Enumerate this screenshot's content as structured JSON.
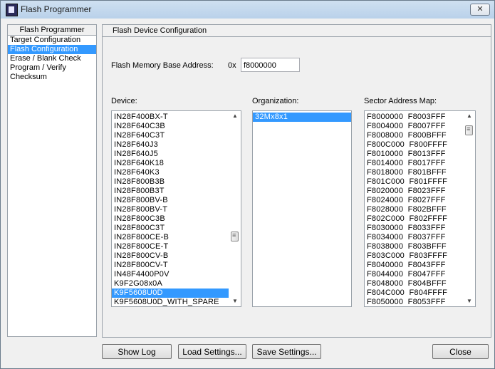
{
  "window": {
    "title": "Flash Programmer",
    "close_label": "✕"
  },
  "nav": {
    "header": "Flash Programmer",
    "items": [
      {
        "label": "Target Configuration",
        "selected": false
      },
      {
        "label": "Flash Configuration",
        "selected": true
      },
      {
        "label": "Erase / Blank Check",
        "selected": false
      },
      {
        "label": "Program / Verify",
        "selected": false
      },
      {
        "label": "Checksum",
        "selected": false
      }
    ]
  },
  "config": {
    "header": "Flash Device Configuration",
    "base_address_label": "Flash Memory Base Address:",
    "base_address_prefix": "0x",
    "base_address_value": "f8000000",
    "device_label": "Device:",
    "organization_label": "Organization:",
    "sector_label": "Sector Address Map:",
    "devices": [
      {
        "label": "IN28F400BX-T",
        "selected": false
      },
      {
        "label": "IN28F640C3B",
        "selected": false
      },
      {
        "label": "IN28F640C3T",
        "selected": false
      },
      {
        "label": "IN28F640J3",
        "selected": false
      },
      {
        "label": "IN28F640J5",
        "selected": false
      },
      {
        "label": "IN28F640K18",
        "selected": false
      },
      {
        "label": "IN28F640K3",
        "selected": false
      },
      {
        "label": "IN28F800B3B",
        "selected": false
      },
      {
        "label": "IN28F800B3T",
        "selected": false
      },
      {
        "label": "IN28F800BV-B",
        "selected": false
      },
      {
        "label": "IN28F800BV-T",
        "selected": false
      },
      {
        "label": "IN28F800C3B",
        "selected": false
      },
      {
        "label": "IN28F800C3T",
        "selected": false
      },
      {
        "label": "IN28F800CE-B",
        "selected": false
      },
      {
        "label": "IN28F800CE-T",
        "selected": false
      },
      {
        "label": "IN28F800CV-B",
        "selected": false
      },
      {
        "label": "IN28F800CV-T",
        "selected": false
      },
      {
        "label": "IN48F4400P0V",
        "selected": false
      },
      {
        "label": "K9F2G08x0A",
        "selected": false
      },
      {
        "label": "K9F5608U0D",
        "selected": true
      },
      {
        "label": "K9F5608U0D_WITH_SPARE",
        "selected": false
      }
    ],
    "organizations": [
      {
        "label": "32Mx8x1",
        "selected": true
      }
    ],
    "sectors": [
      "F8000000  F8003FFF",
      "F8004000  F8007FFF",
      "F8008000  F800BFFF",
      "F800C000  F800FFFF",
      "F8010000  F8013FFF",
      "F8014000  F8017FFF",
      "F8018000  F801BFFF",
      "F801C000  F801FFFF",
      "F8020000  F8023FFF",
      "F8024000  F8027FFF",
      "F8028000  F802BFFF",
      "F802C000  F802FFFF",
      "F8030000  F8033FFF",
      "F8034000  F8037FFF",
      "F8038000  F803BFFF",
      "F803C000  F803FFFF",
      "F8040000  F8043FFF",
      "F8044000  F8047FFF",
      "F8048000  F804BFFF",
      "F804C000  F804FFFF",
      "F8050000  F8053FFF"
    ]
  },
  "buttons": {
    "show_log": "Show Log",
    "load_settings": "Load Settings...",
    "save_settings": "Save Settings...",
    "close": "Close"
  }
}
